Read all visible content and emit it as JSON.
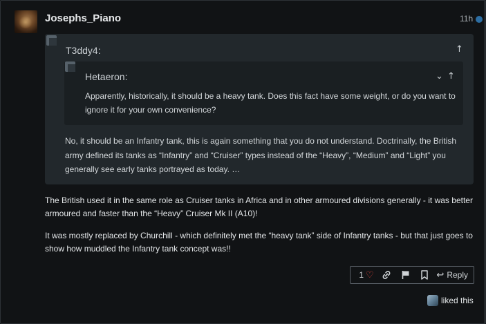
{
  "post": {
    "username": "Josephs_Piano",
    "time": "11h",
    "quote": {
      "author": "T3ddy4:",
      "nested": {
        "author": "Hetaeron:",
        "text_line1": "Apparently, historically, it should be a heavy tank. Does this fact have some weight, or do you want to",
        "text_line2": "ignore it for your own convenience?"
      },
      "text_line1": "No, it should be an Infantry tank, this is again something that you do not understand. Doctrinally, the British",
      "text_line2": "army defined its tanks as “Infantry” and “Cruiser” types instead of the “Heavy”, “Medium” and “Light” you",
      "text_line3": "generally see early tanks portrayed as today. …"
    },
    "paragraph1_line1": "The British used it in the same role as Cruiser tanks in Africa and in other armoured divisions generally - it was better",
    "paragraph1_line2": "armoured and faster than the “Heavy” Cruiser Mk II (A10)!",
    "paragraph2_line1": "It was mostly replaced by Churchill - which definitely met the “heavy tank” side of Infantry tanks - but that just goes to",
    "paragraph2_line2": "show how muddled the Infantry tank concept was!!",
    "actions": {
      "like_count": "1",
      "reply_label": "Reply"
    },
    "liked_text": "liked this"
  },
  "colors": {
    "heart": "#e0443a",
    "unread_dot": "#2d6ea3",
    "quote_bg": "#22282c",
    "nested_quote_bg": "#1a1f22"
  },
  "icons": [
    "heart-icon",
    "link-icon",
    "flag-icon",
    "bookmark-icon",
    "reply-icon",
    "arrow-up-icon",
    "chevron-down-icon"
  ]
}
